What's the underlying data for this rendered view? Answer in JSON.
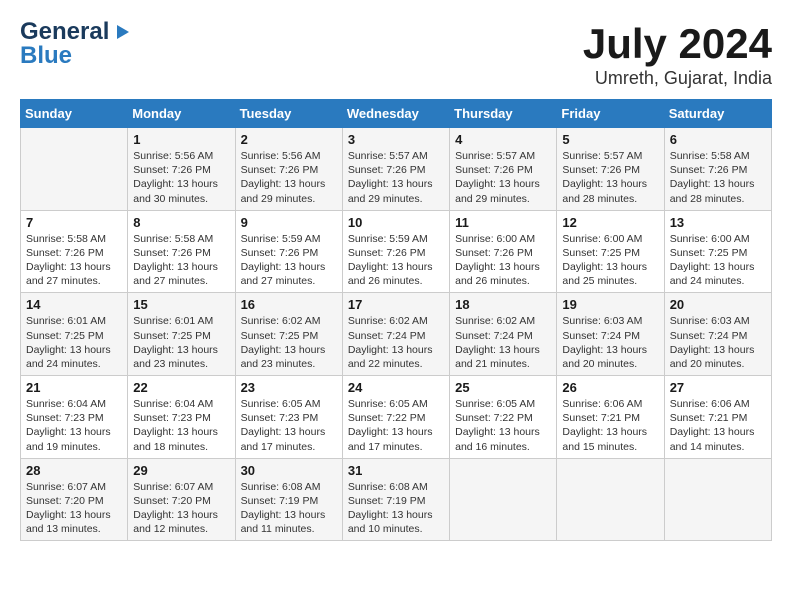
{
  "header": {
    "logo_line1": "General",
    "logo_line2": "Blue",
    "month": "July 2024",
    "location": "Umreth, Gujarat, India"
  },
  "columns": [
    "Sunday",
    "Monday",
    "Tuesday",
    "Wednesday",
    "Thursday",
    "Friday",
    "Saturday"
  ],
  "weeks": [
    [
      {
        "day": "",
        "info": ""
      },
      {
        "day": "1",
        "info": "Sunrise: 5:56 AM\nSunset: 7:26 PM\nDaylight: 13 hours\nand 30 minutes."
      },
      {
        "day": "2",
        "info": "Sunrise: 5:56 AM\nSunset: 7:26 PM\nDaylight: 13 hours\nand 29 minutes."
      },
      {
        "day": "3",
        "info": "Sunrise: 5:57 AM\nSunset: 7:26 PM\nDaylight: 13 hours\nand 29 minutes."
      },
      {
        "day": "4",
        "info": "Sunrise: 5:57 AM\nSunset: 7:26 PM\nDaylight: 13 hours\nand 29 minutes."
      },
      {
        "day": "5",
        "info": "Sunrise: 5:57 AM\nSunset: 7:26 PM\nDaylight: 13 hours\nand 28 minutes."
      },
      {
        "day": "6",
        "info": "Sunrise: 5:58 AM\nSunset: 7:26 PM\nDaylight: 13 hours\nand 28 minutes."
      }
    ],
    [
      {
        "day": "7",
        "info": "Sunrise: 5:58 AM\nSunset: 7:26 PM\nDaylight: 13 hours\nand 27 minutes."
      },
      {
        "day": "8",
        "info": "Sunrise: 5:58 AM\nSunset: 7:26 PM\nDaylight: 13 hours\nand 27 minutes."
      },
      {
        "day": "9",
        "info": "Sunrise: 5:59 AM\nSunset: 7:26 PM\nDaylight: 13 hours\nand 27 minutes."
      },
      {
        "day": "10",
        "info": "Sunrise: 5:59 AM\nSunset: 7:26 PM\nDaylight: 13 hours\nand 26 minutes."
      },
      {
        "day": "11",
        "info": "Sunrise: 6:00 AM\nSunset: 7:26 PM\nDaylight: 13 hours\nand 26 minutes."
      },
      {
        "day": "12",
        "info": "Sunrise: 6:00 AM\nSunset: 7:25 PM\nDaylight: 13 hours\nand 25 minutes."
      },
      {
        "day": "13",
        "info": "Sunrise: 6:00 AM\nSunset: 7:25 PM\nDaylight: 13 hours\nand 24 minutes."
      }
    ],
    [
      {
        "day": "14",
        "info": "Sunrise: 6:01 AM\nSunset: 7:25 PM\nDaylight: 13 hours\nand 24 minutes."
      },
      {
        "day": "15",
        "info": "Sunrise: 6:01 AM\nSunset: 7:25 PM\nDaylight: 13 hours\nand 23 minutes."
      },
      {
        "day": "16",
        "info": "Sunrise: 6:02 AM\nSunset: 7:25 PM\nDaylight: 13 hours\nand 23 minutes."
      },
      {
        "day": "17",
        "info": "Sunrise: 6:02 AM\nSunset: 7:24 PM\nDaylight: 13 hours\nand 22 minutes."
      },
      {
        "day": "18",
        "info": "Sunrise: 6:02 AM\nSunset: 7:24 PM\nDaylight: 13 hours\nand 21 minutes."
      },
      {
        "day": "19",
        "info": "Sunrise: 6:03 AM\nSunset: 7:24 PM\nDaylight: 13 hours\nand 20 minutes."
      },
      {
        "day": "20",
        "info": "Sunrise: 6:03 AM\nSunset: 7:24 PM\nDaylight: 13 hours\nand 20 minutes."
      }
    ],
    [
      {
        "day": "21",
        "info": "Sunrise: 6:04 AM\nSunset: 7:23 PM\nDaylight: 13 hours\nand 19 minutes."
      },
      {
        "day": "22",
        "info": "Sunrise: 6:04 AM\nSunset: 7:23 PM\nDaylight: 13 hours\nand 18 minutes."
      },
      {
        "day": "23",
        "info": "Sunrise: 6:05 AM\nSunset: 7:23 PM\nDaylight: 13 hours\nand 17 minutes."
      },
      {
        "day": "24",
        "info": "Sunrise: 6:05 AM\nSunset: 7:22 PM\nDaylight: 13 hours\nand 17 minutes."
      },
      {
        "day": "25",
        "info": "Sunrise: 6:05 AM\nSunset: 7:22 PM\nDaylight: 13 hours\nand 16 minutes."
      },
      {
        "day": "26",
        "info": "Sunrise: 6:06 AM\nSunset: 7:21 PM\nDaylight: 13 hours\nand 15 minutes."
      },
      {
        "day": "27",
        "info": "Sunrise: 6:06 AM\nSunset: 7:21 PM\nDaylight: 13 hours\nand 14 minutes."
      }
    ],
    [
      {
        "day": "28",
        "info": "Sunrise: 6:07 AM\nSunset: 7:20 PM\nDaylight: 13 hours\nand 13 minutes."
      },
      {
        "day": "29",
        "info": "Sunrise: 6:07 AM\nSunset: 7:20 PM\nDaylight: 13 hours\nand 12 minutes."
      },
      {
        "day": "30",
        "info": "Sunrise: 6:08 AM\nSunset: 7:19 PM\nDaylight: 13 hours\nand 11 minutes."
      },
      {
        "day": "31",
        "info": "Sunrise: 6:08 AM\nSunset: 7:19 PM\nDaylight: 13 hours\nand 10 minutes."
      },
      {
        "day": "",
        "info": ""
      },
      {
        "day": "",
        "info": ""
      },
      {
        "day": "",
        "info": ""
      }
    ]
  ]
}
